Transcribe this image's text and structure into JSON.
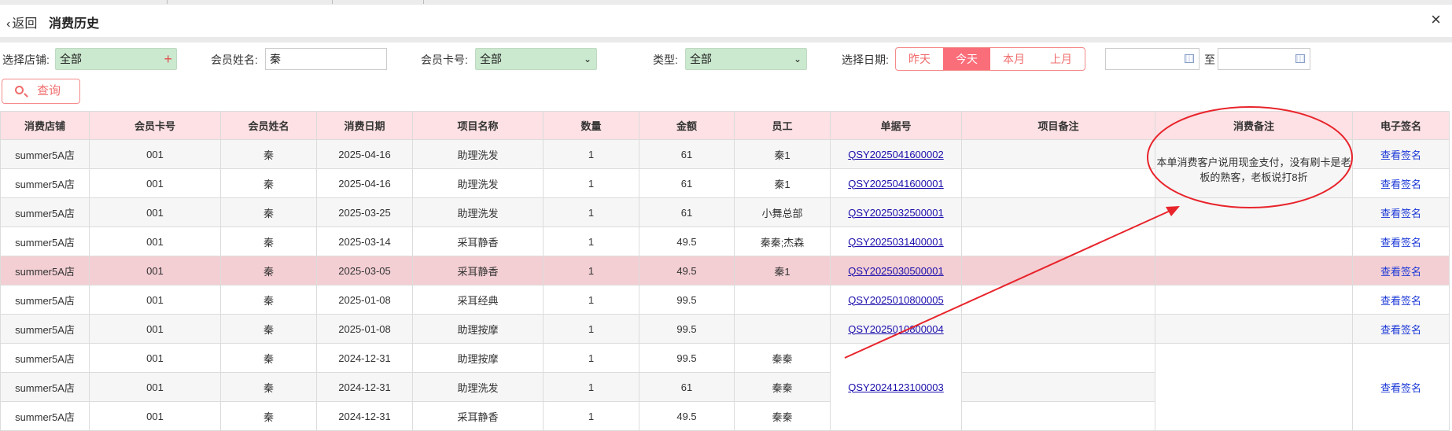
{
  "header": {
    "back_label": "返回",
    "title": "消费历史",
    "close_label": "×"
  },
  "filters": {
    "store_label": "选择店铺:",
    "store_value": "全部",
    "member_name_label": "会员姓名:",
    "member_name_value": "秦",
    "member_card_label": "会员卡号:",
    "member_card_value": "全部",
    "type_label": "类型:",
    "type_value": "全部",
    "date_label": "选择日期:",
    "date_ranges": [
      "昨天",
      "今天",
      "本月",
      "上月"
    ],
    "active_range": "今天",
    "to_label": "至",
    "query_label": "查询"
  },
  "table": {
    "columns": [
      "消费店铺",
      "会员卡号",
      "会员姓名",
      "消费日期",
      "项目名称",
      "数量",
      "金额",
      "员工",
      "单据号",
      "项目备注",
      "消费备注",
      "电子签名"
    ],
    "sig_label": "查看签名",
    "note_text": "本单消费客户说用现金支付，没有刷卡是老板的熟客，老板说打8折",
    "rows": [
      {
        "store": "summer5A店",
        "card": "001",
        "name": "秦",
        "date": "2025-04-16",
        "item": "助理洗发",
        "qty": "1",
        "amount": "61",
        "staff": "秦1",
        "order": "QSY2025041600002"
      },
      {
        "store": "summer5A店",
        "card": "001",
        "name": "秦",
        "date": "2025-04-16",
        "item": "助理洗发",
        "qty": "1",
        "amount": "61",
        "staff": "秦1",
        "order": "QSY2025041600001"
      },
      {
        "store": "summer5A店",
        "card": "001",
        "name": "秦",
        "date": "2025-03-25",
        "item": "助理洗发",
        "qty": "1",
        "amount": "61",
        "staff": "小舞总部",
        "order": "QSY2025032500001"
      },
      {
        "store": "summer5A店",
        "card": "001",
        "name": "秦",
        "date": "2025-03-14",
        "item": "采耳静香",
        "qty": "1",
        "amount": "49.5",
        "staff": "秦秦;杰森",
        "order": "QSY2025031400001"
      },
      {
        "store": "summer5A店",
        "card": "001",
        "name": "秦",
        "date": "2025-03-05",
        "item": "采耳静香",
        "qty": "1",
        "amount": "49.5",
        "staff": "秦1",
        "order": "QSY2025030500001"
      },
      {
        "store": "summer5A店",
        "card": "001",
        "name": "秦",
        "date": "2025-01-08",
        "item": "采耳经典",
        "qty": "1",
        "amount": "99.5",
        "staff": "",
        "order": "QSY2025010800005"
      },
      {
        "store": "summer5A店",
        "card": "001",
        "name": "秦",
        "date": "2025-01-08",
        "item": "助理按摩",
        "qty": "1",
        "amount": "99.5",
        "staff": "",
        "order": "QSY2025010800004"
      },
      {
        "store": "summer5A店",
        "card": "001",
        "name": "秦",
        "date": "2024-12-31",
        "item": "助理按摩",
        "qty": "1",
        "amount": "99.5",
        "staff": "秦秦",
        "order": "QSY2024123100003"
      },
      {
        "store": "summer5A店",
        "card": "001",
        "name": "秦",
        "date": "2024-12-31",
        "item": "助理洗发",
        "qty": "1",
        "amount": "61",
        "staff": "秦秦",
        "order": ""
      },
      {
        "store": "summer5A店",
        "card": "001",
        "name": "秦",
        "date": "2024-12-31",
        "item": "采耳静香",
        "qty": "1",
        "amount": "49.5",
        "staff": "秦秦",
        "order": ""
      }
    ],
    "selected_row": 4
  },
  "annotation": {
    "stroke_color": "#e8242b"
  },
  "colors": {
    "accent": "#f06b6b",
    "header_bg": "#fde1e4",
    "green_select": "#cbe9cf",
    "selected_row": "#f3cfd3",
    "link": "#1a0dab"
  }
}
